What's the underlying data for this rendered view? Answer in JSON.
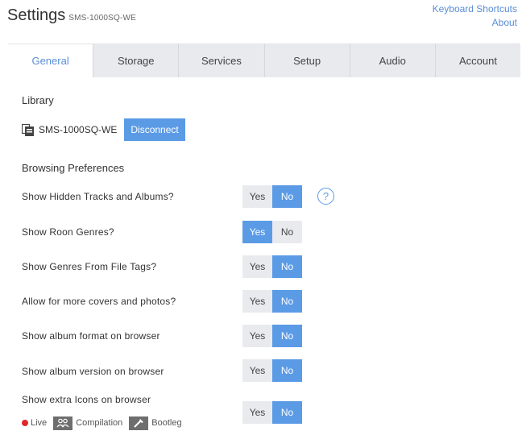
{
  "header": {
    "title": "Settings",
    "subtitle": "SMS-1000SQ-WE",
    "links": [
      "Keyboard Shortcuts",
      "About"
    ]
  },
  "tabs": [
    {
      "label": "General",
      "active": true
    },
    {
      "label": "Storage",
      "active": false
    },
    {
      "label": "Services",
      "active": false
    },
    {
      "label": "Setup",
      "active": false
    },
    {
      "label": "Audio",
      "active": false
    },
    {
      "label": "Account",
      "active": false
    }
  ],
  "library": {
    "heading": "Library",
    "device_name": "SMS-1000SQ-WE",
    "disconnect_label": "Disconnect"
  },
  "browsing": {
    "heading": "Browsing Preferences",
    "yes_label": "Yes",
    "no_label": "No",
    "help_glyph": "?",
    "prefs": [
      {
        "label": "Show Hidden Tracks and Albums?",
        "selected": "No"
      },
      {
        "label": "Show Roon Genres?",
        "selected": "Yes"
      },
      {
        "label": "Show Genres From File Tags?",
        "selected": "No"
      },
      {
        "label": "Allow for more covers and photos?",
        "selected": "No"
      },
      {
        "label": "Show album format on browser",
        "selected": "No"
      },
      {
        "label": "Show album version on browser",
        "selected": "No"
      },
      {
        "label": "Show extra Icons on browser",
        "selected": "No"
      }
    ]
  },
  "legend": {
    "live": "Live",
    "compilation": "Compilation",
    "bootleg": "Bootleg"
  },
  "colors": {
    "accent": "#5b9be6",
    "tab_bg": "#e9eaee",
    "live": "#e02828"
  }
}
